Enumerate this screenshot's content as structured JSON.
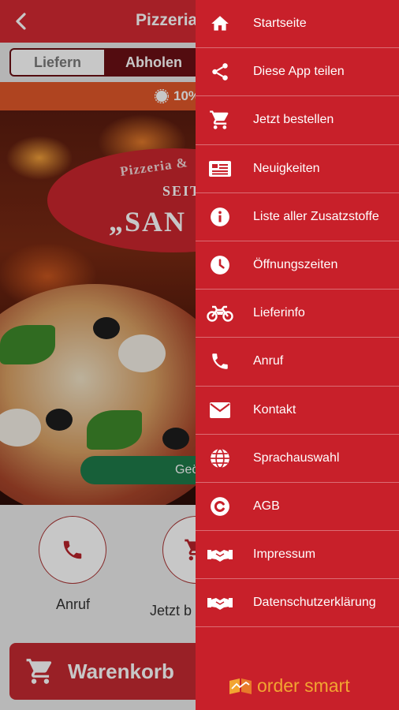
{
  "header": {
    "title": "Pizzeria San"
  },
  "mode_tabs": {
    "delivery": "Liefern",
    "pickup": "Abholen",
    "selected": "Abholen"
  },
  "promo": {
    "text": "10%"
  },
  "hero": {
    "logo_line1": "Pizzeria &",
    "logo_line2": "SEIT",
    "logo_line3": "„SAN",
    "pill_text": "Geö"
  },
  "actions": {
    "call_label": "Anruf",
    "order_label": "Jetzt b"
  },
  "cart": {
    "label": "Warenkorb"
  },
  "drawer": {
    "items": [
      {
        "label": "Startseite",
        "icon": "home-icon"
      },
      {
        "label": "Diese App teilen",
        "icon": "share-icon"
      },
      {
        "label": "Jetzt bestellen",
        "icon": "cart-icon"
      },
      {
        "label": "Neuigkeiten",
        "icon": "news-icon"
      },
      {
        "label": "Liste aller Zusatzstoffe",
        "icon": "info-icon"
      },
      {
        "label": "Öffnungszeiten",
        "icon": "clock-icon"
      },
      {
        "label": "Lieferinfo",
        "icon": "motorbike-icon"
      },
      {
        "label": "Anruf",
        "icon": "phone-icon"
      },
      {
        "label": "Kontakt",
        "icon": "mail-icon"
      },
      {
        "label": "Sprachauswahl",
        "icon": "globe-icon"
      },
      {
        "label": "AGB",
        "icon": "copyright-icon"
      },
      {
        "label": "Impressum",
        "icon": "handshake-icon"
      },
      {
        "label": "Datenschutzerklärung",
        "icon": "handshake-icon"
      }
    ],
    "brand": "order smart"
  },
  "colors": {
    "primary": "#d42a33",
    "drawer": "#c8202a",
    "dark": "#6b1015",
    "promo": "#e0582a",
    "brand": "#f2a531"
  }
}
